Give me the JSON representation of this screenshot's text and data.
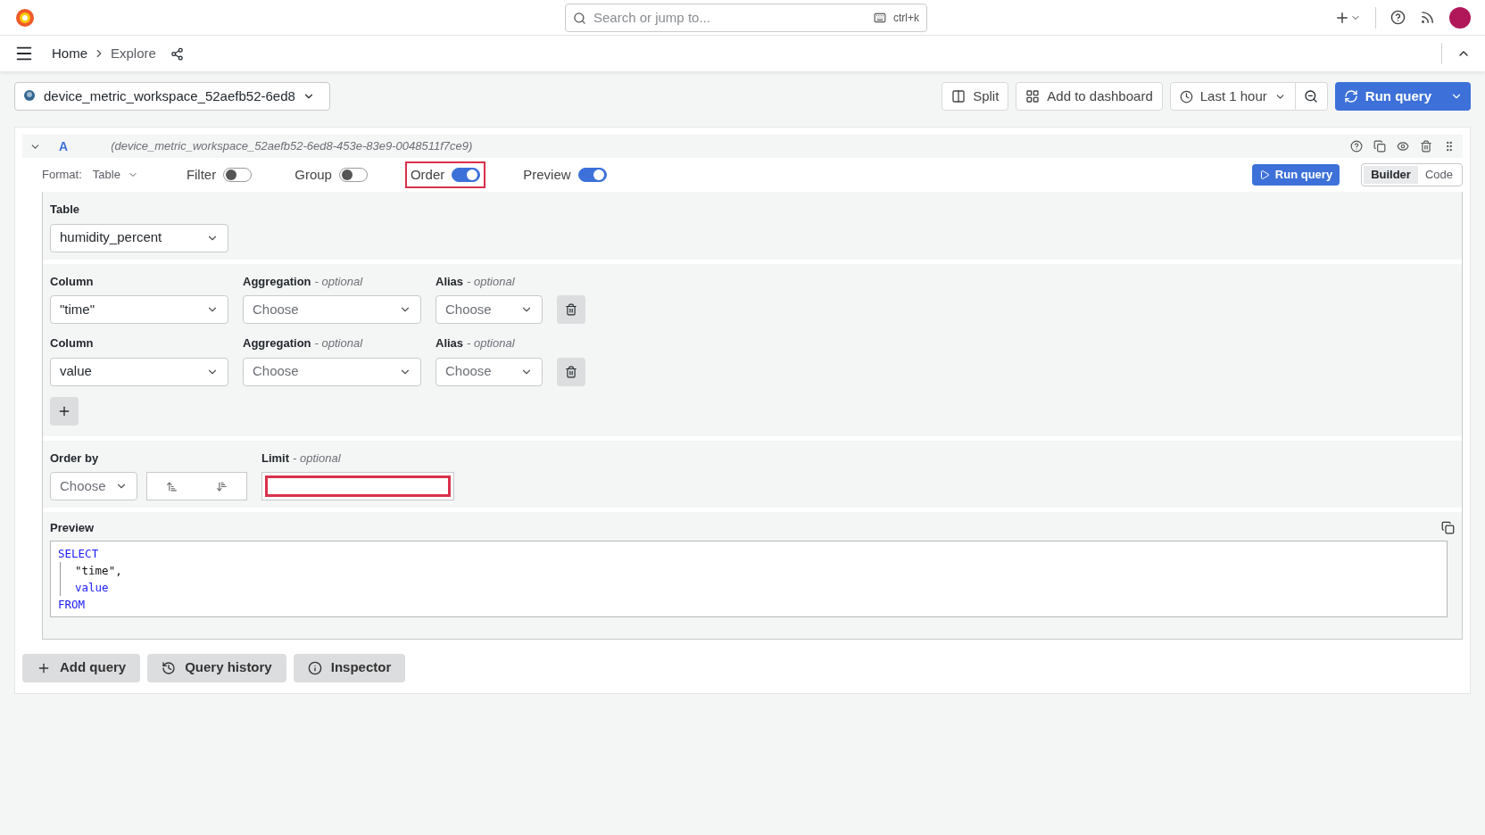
{
  "topbar": {
    "search_placeholder": "Search or jump to...",
    "shortcut": "ctrl+k"
  },
  "breadcrumbs": [
    "Home",
    "Explore"
  ],
  "datasource": {
    "name": "device_metric_workspace_52aefb52-6ed8"
  },
  "toolbar": {
    "split": "Split",
    "add_to_dashboard": "Add to dashboard",
    "time_range": "Last 1 hour",
    "run_query": "Run query"
  },
  "query": {
    "letter": "A",
    "source": "(device_metric_workspace_52aefb52-6ed8-453e-83e9-0048511f7ce9)",
    "format_label": "Format:",
    "format_value": "Table",
    "toggles": [
      {
        "label": "Filter",
        "on": false,
        "highlighted": false
      },
      {
        "label": "Group",
        "on": false,
        "highlighted": false
      },
      {
        "label": "Order",
        "on": true,
        "highlighted": true
      },
      {
        "label": "Preview",
        "on": true,
        "highlighted": false
      }
    ],
    "run_query": "Run query",
    "modes": [
      {
        "label": "Builder",
        "selected": true
      },
      {
        "label": "Code",
        "selected": false
      }
    ],
    "table": {
      "label": "Table",
      "value": "humidity_percent"
    },
    "columns": [
      {
        "column_label": "Column",
        "column_value": "\"time\"",
        "aggregation_label": "Aggregation",
        "aggregation_hint": "- optional",
        "aggregation_placeholder": "Choose",
        "alias_label": "Alias",
        "alias_hint": "- optional",
        "alias_placeholder": "Choose"
      },
      {
        "column_label": "Column",
        "column_value": "value",
        "aggregation_label": "Aggregation",
        "aggregation_hint": "- optional",
        "aggregation_placeholder": "Choose",
        "alias_label": "Alias",
        "alias_hint": "- optional",
        "alias_placeholder": "Choose"
      }
    ],
    "order_by": {
      "label": "Order by",
      "placeholder": "Choose"
    },
    "limit": {
      "label": "Limit",
      "hint": "- optional",
      "highlighted": true
    },
    "preview": {
      "label": "Preview",
      "lines": [
        {
          "text": "SELECT",
          "kind": "keyword",
          "indented": false
        },
        {
          "text": "\"time\",",
          "kind": "plain",
          "indented": true
        },
        {
          "text": "value",
          "kind": "keyword",
          "indented": true
        },
        {
          "text": "FROM",
          "kind": "keyword",
          "indented": false
        }
      ]
    }
  },
  "footer": [
    {
      "label": "Add query",
      "kind": "add"
    },
    {
      "label": "Query history",
      "kind": "history"
    },
    {
      "label": "Inspector",
      "kind": "info"
    }
  ]
}
